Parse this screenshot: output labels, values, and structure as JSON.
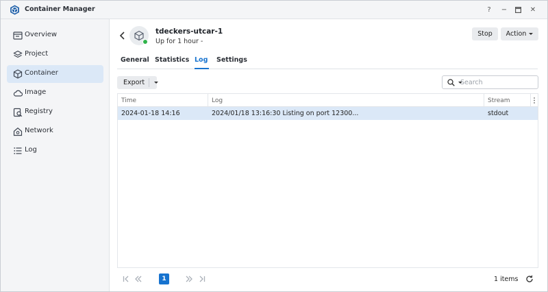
{
  "window": {
    "title": "Container Manager",
    "controls": [
      "?",
      "−",
      "□",
      "✕"
    ]
  },
  "sidebar": {
    "items": [
      {
        "label": "Overview",
        "icon": "overview-icon",
        "active": false
      },
      {
        "label": "Project",
        "icon": "project-icon",
        "active": false
      },
      {
        "label": "Container",
        "icon": "container-icon",
        "active": true
      },
      {
        "label": "Image",
        "icon": "image-cloud-icon",
        "active": false
      },
      {
        "label": "Registry",
        "icon": "registry-icon",
        "active": false
      },
      {
        "label": "Network",
        "icon": "network-icon",
        "active": false
      },
      {
        "label": "Log",
        "icon": "log-list-icon",
        "active": false
      }
    ]
  },
  "container": {
    "name": "tdeckers-utcar-1",
    "status": "Up for 1 hour -",
    "status_color": "#2fb34a"
  },
  "actions": {
    "stop_label": "Stop",
    "action_label": "Action"
  },
  "tabs": [
    "General",
    "Statistics",
    "Log",
    "Settings"
  ],
  "active_tab": "Log",
  "toolbar": {
    "export_label": "Export",
    "search_placeholder": "Search"
  },
  "log_table": {
    "columns": [
      "Time",
      "Log",
      "Stream"
    ],
    "rows": [
      {
        "time": "2024-01-18 14:16",
        "log": "2024/01/18 13:16:30 Listing on port 12300...",
        "stream": "stdout"
      }
    ]
  },
  "pagination": {
    "current_page": "1",
    "items_count": "1 items"
  },
  "colors": {
    "accent": "#1773cf",
    "selected_row": "#dbe8f7",
    "sidebar_bg": "#f4f5f7"
  }
}
